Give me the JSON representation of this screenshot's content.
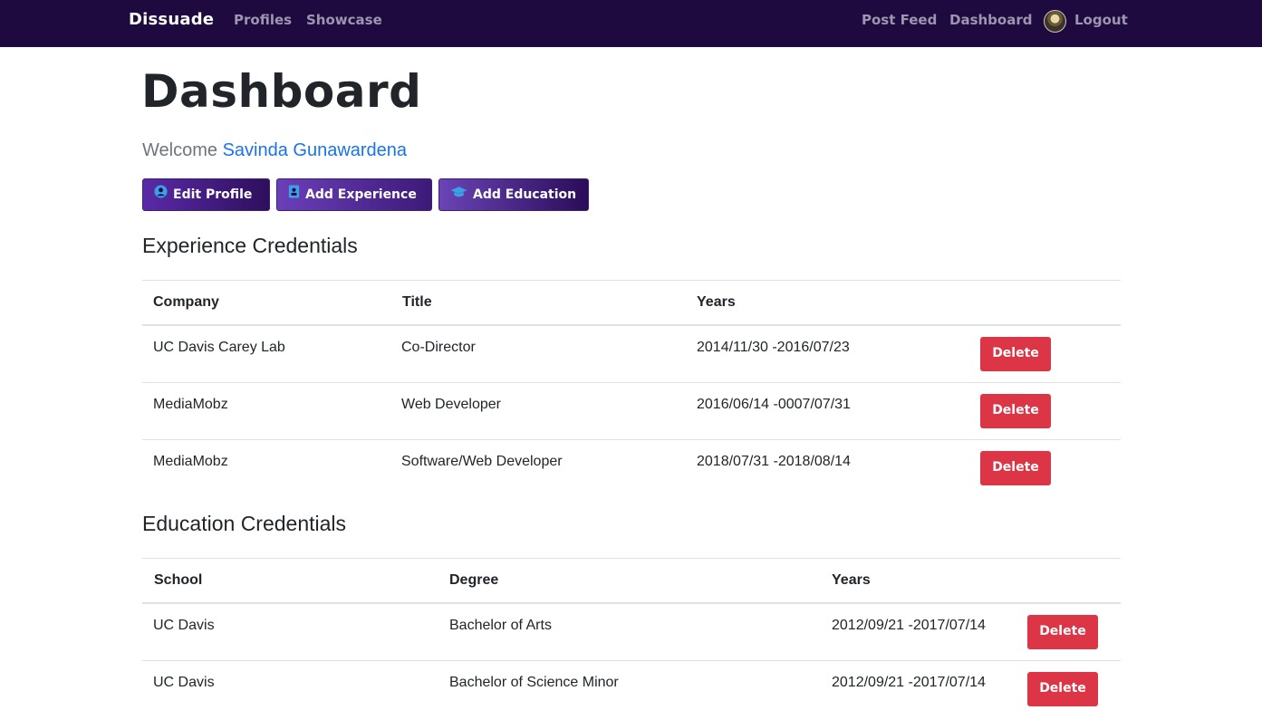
{
  "nav": {
    "brand": "Dissuade",
    "left_links": [
      "Profiles",
      "Showcase"
    ],
    "right_links": [
      "Post Feed",
      "Dashboard"
    ],
    "logout": "Logout"
  },
  "page": {
    "title": "Dashboard",
    "welcome_prefix": "Welcome",
    "user_name": "Savinda Gunawardena"
  },
  "actions": [
    {
      "label": "Edit Profile",
      "icon": "user-circle-icon"
    },
    {
      "label": "Add Experience",
      "icon": "id-badge-icon"
    },
    {
      "label": "Add Education",
      "icon": "graduation-cap-icon"
    }
  ],
  "experience": {
    "title": "Experience Credentials",
    "headers": [
      "Company",
      "Title",
      "Years"
    ],
    "rows": [
      {
        "company": "UC Davis Carey Lab",
        "title": "Co-Director",
        "years": "2014/11/30 -2016/07/23"
      },
      {
        "company": "MediaMobz",
        "title": "Web Developer",
        "years": "2016/06/14 -0007/07/31"
      },
      {
        "company": "MediaMobz",
        "title": "Software/Web Developer",
        "years": "2018/07/31 -2018/08/14"
      }
    ]
  },
  "education": {
    "title": "Education Credentials",
    "headers": [
      "School",
      "Degree",
      "Years"
    ],
    "rows": [
      {
        "school": "UC Davis",
        "degree": "Bachelor of Arts",
        "years": "2012/09/21 -2017/07/14"
      },
      {
        "school": "UC Davis",
        "degree": "Bachelor of Science Minor",
        "years": "2012/09/21 -2017/07/14"
      }
    ]
  },
  "delete_label": "Delete",
  "colors": {
    "navbar": "#1f0a3f",
    "accent_link": "#1a73e8",
    "danger": "#dc3545",
    "button_purple": "#5a2aa8"
  }
}
